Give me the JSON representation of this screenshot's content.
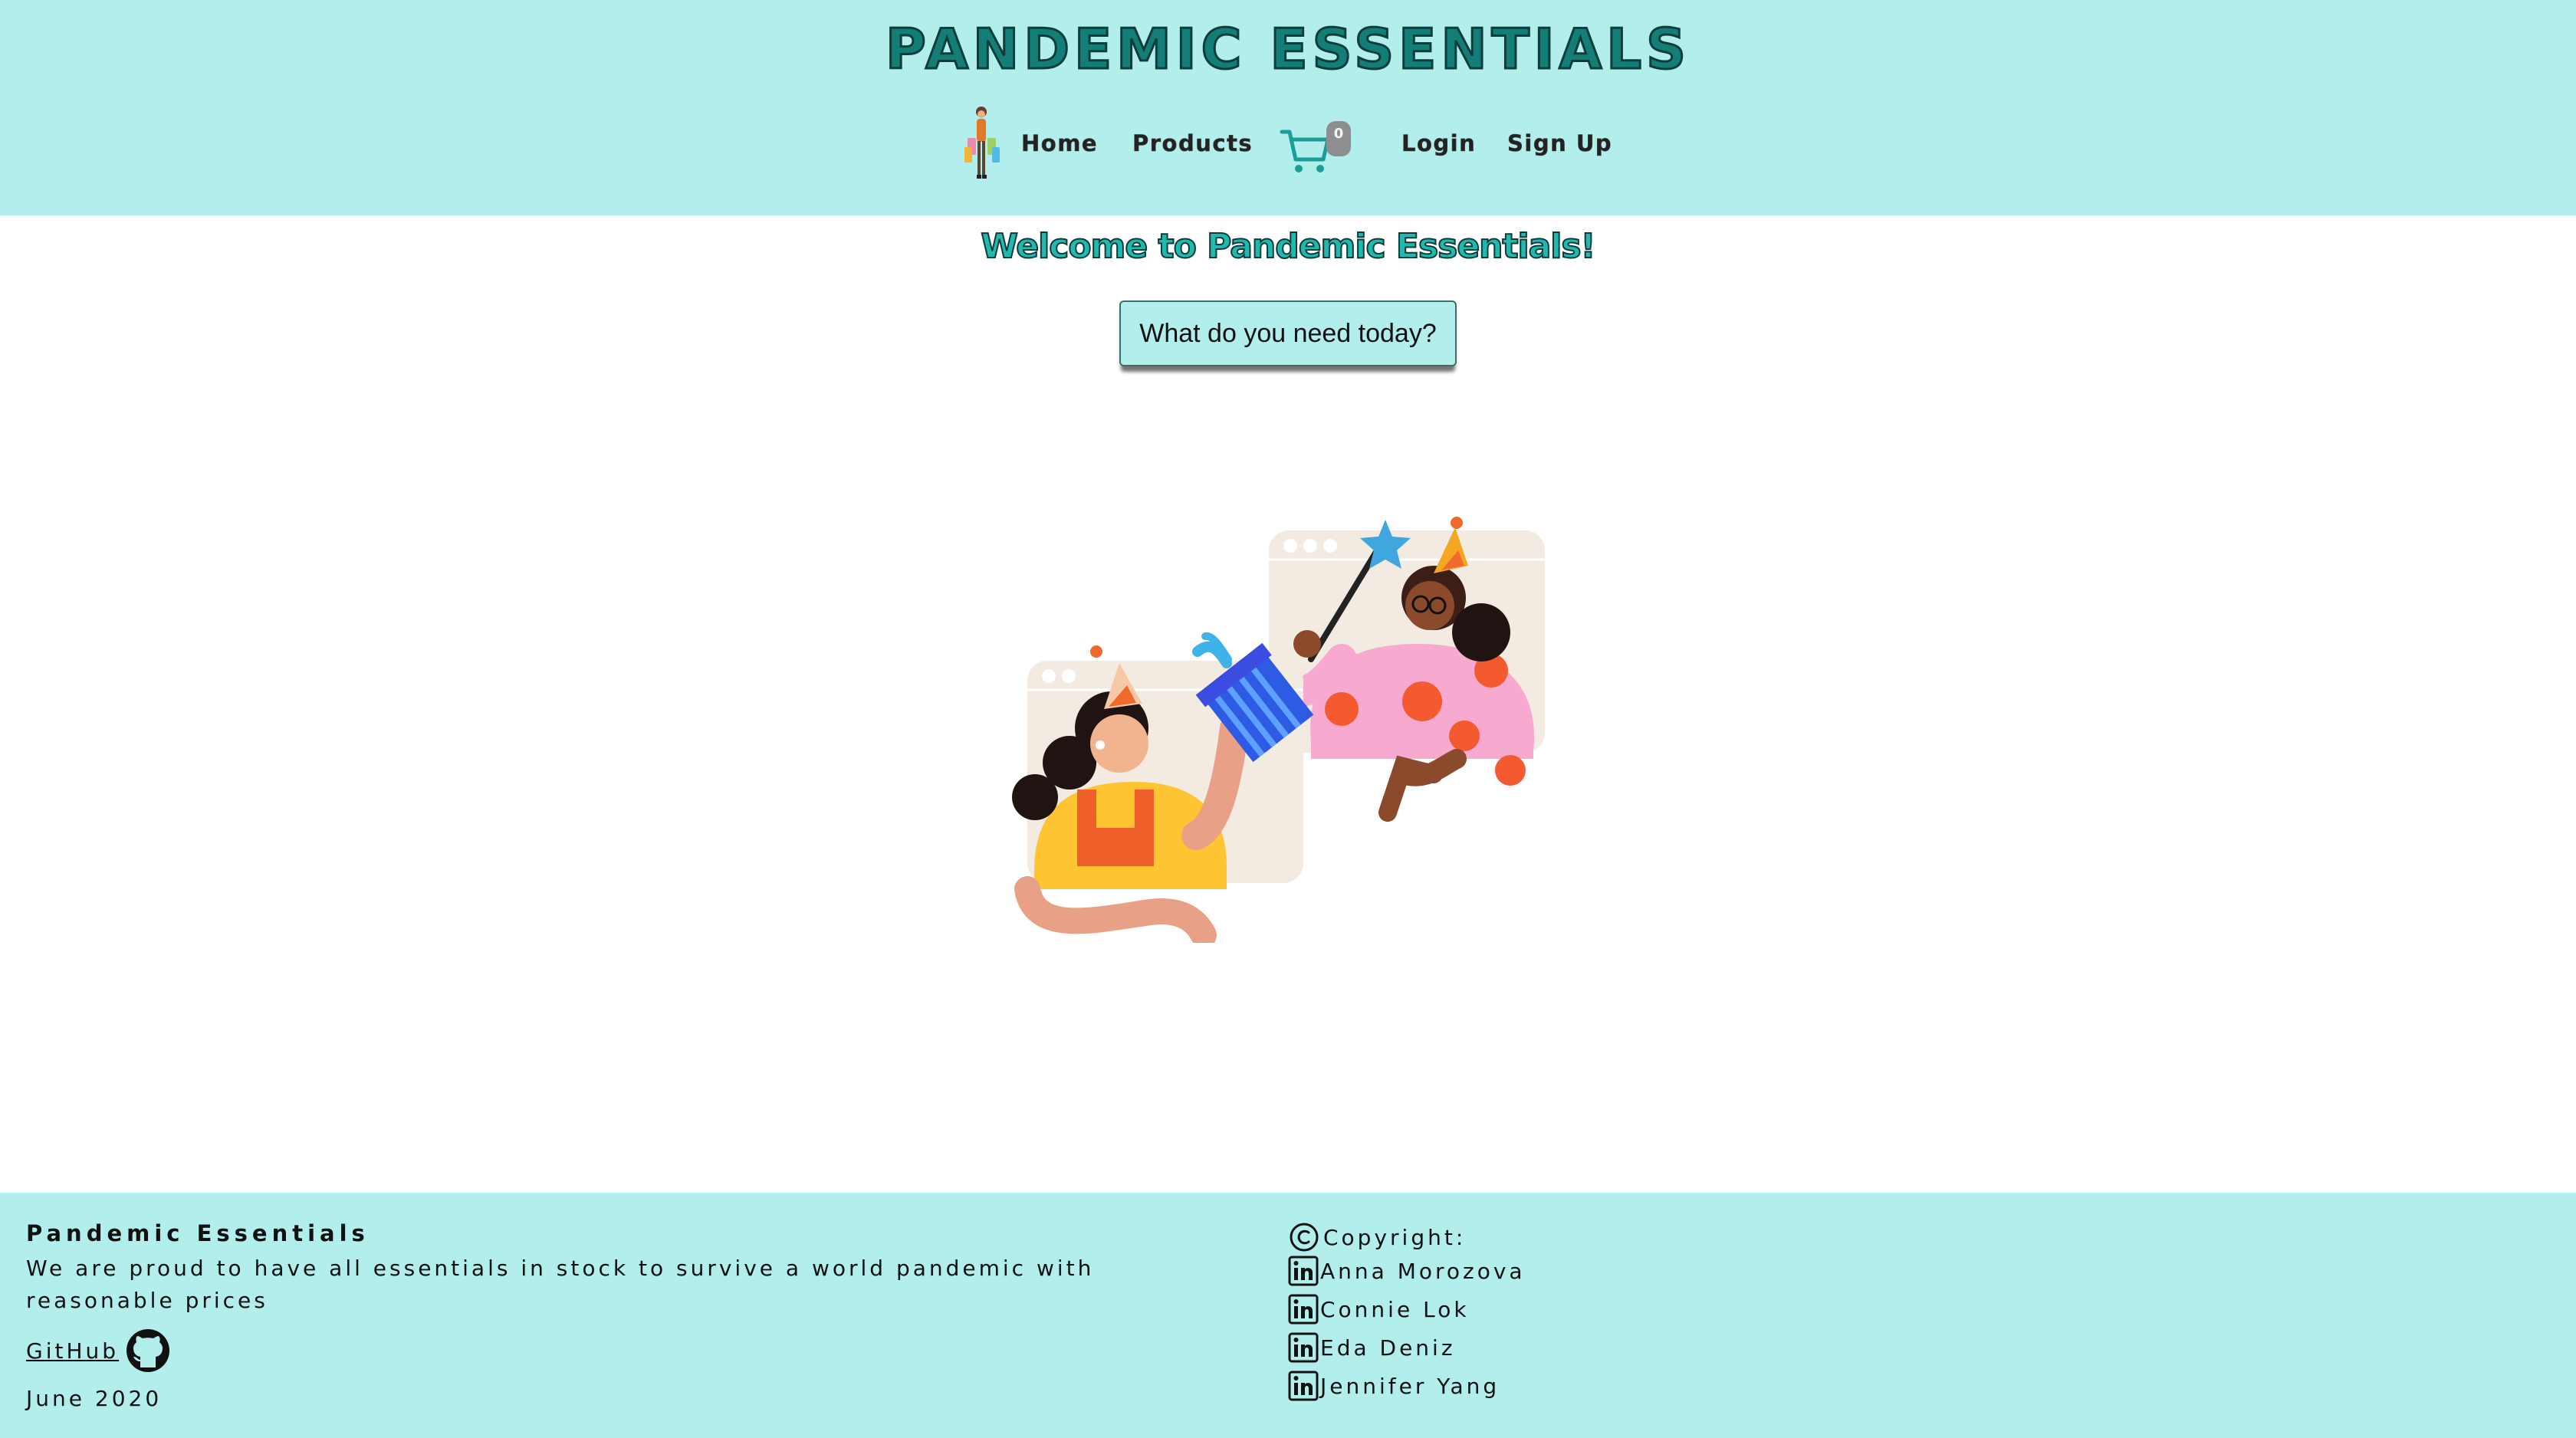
{
  "header": {
    "brand": "PANDEMIC ESSENTIALS",
    "nav": {
      "home": "Home",
      "products": "Products",
      "cart_count": "0",
      "login": "Login",
      "signup": "Sign Up"
    }
  },
  "main": {
    "welcome": "Welcome to Pandemic Essentials!",
    "cta_label": "What do you need today?"
  },
  "footer": {
    "title": "Pandemic Essentials",
    "description": "We are proud to have all essentials in stock to survive a world pandemic with reasonable prices",
    "github_label": "GitHub",
    "date": "June 2020",
    "copyright_label": "Copyright:",
    "authors": [
      "Anna Morozova",
      "Connie Lok",
      "Eda Deniz",
      "Jennifer Yang"
    ]
  },
  "colors": {
    "header_bg": "#b1eeec",
    "brand_teal": "#137d78",
    "cart_teal": "#1a9e98",
    "badge_gray": "#8e8e8e"
  },
  "icons": [
    "shopper-icon",
    "cart-icon",
    "github-icon",
    "copyright-icon",
    "linkedin-icon"
  ]
}
